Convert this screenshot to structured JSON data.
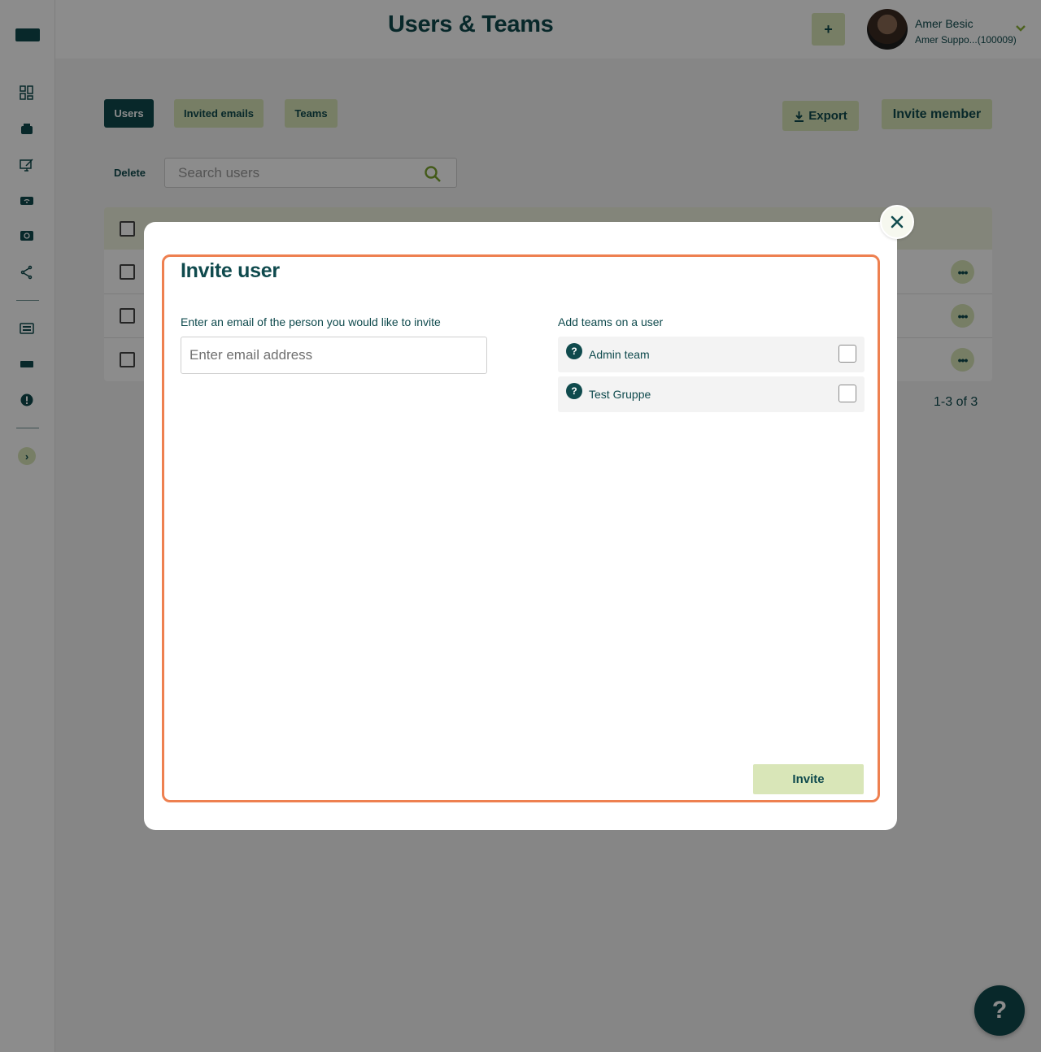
{
  "header": {
    "title": "Users & Teams",
    "plus_label": "+",
    "user_name": "Amer Besic",
    "user_org": "Amer Suppo...(100009)"
  },
  "tabs": [
    {
      "label": "Users",
      "active": true
    },
    {
      "label": "Invited emails",
      "active": false
    },
    {
      "label": "Teams",
      "active": false
    }
  ],
  "toolbar": {
    "export_label": "Export",
    "invite_member_label": "Invite member",
    "delete_label": "Delete",
    "search_placeholder": "Search users"
  },
  "table": {
    "pagination": "1-3 of 3",
    "row_action_label": "•••"
  },
  "help": {
    "label": "?"
  },
  "modal": {
    "title": "Invite user",
    "email_label": "Enter an email of the person you would like to invite",
    "email_placeholder": "Enter email address",
    "email_value": "",
    "teams_label": "Add teams on a user",
    "teams": [
      {
        "name": "Admin team",
        "checked": false
      },
      {
        "name": "Test Gruppe",
        "checked": false
      }
    ],
    "team_help_glyph": "?",
    "invite_label": "Invite"
  },
  "colors": {
    "primary": "#0f4a4d",
    "accent": "#d9e6b8",
    "highlight": "#ee8050"
  }
}
